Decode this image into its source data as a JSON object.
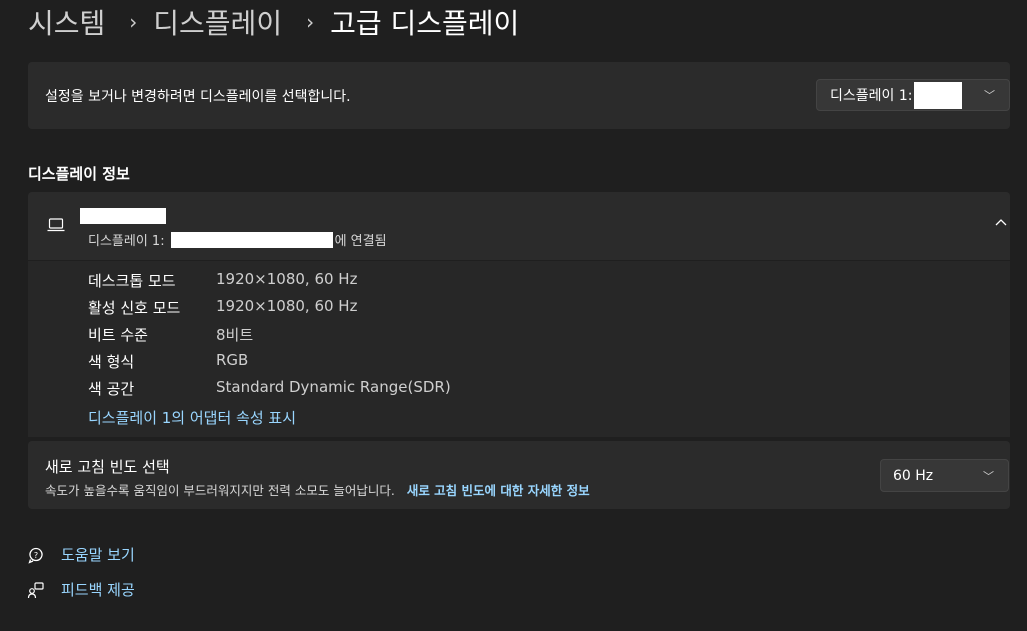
{
  "breadcrumb": {
    "items": [
      "시스템",
      "디스플레이",
      "고급 디스플레이"
    ],
    "separator": "›"
  },
  "display_select": {
    "prompt": "설정을 보거나 변경하려면 디스플레이를 선택합니다.",
    "selected": "디스플레이 1:"
  },
  "info": {
    "section_title": "디스플레이 정보",
    "connection_prefix": "디스플레이 1:",
    "connection_suffix": "에 연결됨",
    "rows": [
      {
        "label": "데스크톱 모드",
        "value": "1920×1080, 60 Hz"
      },
      {
        "label": "활성 신호 모드",
        "value": "1920×1080, 60 Hz"
      },
      {
        "label": "비트 수준",
        "value": "8비트"
      },
      {
        "label": "색 형식",
        "value": "RGB"
      },
      {
        "label": "색 공간",
        "value": "Standard Dynamic Range(SDR)"
      }
    ],
    "adapter_link": "디스플레이 1의 어댑터 속성 표시"
  },
  "refresh": {
    "title": "새로 고침 빈도 선택",
    "description": "속도가 높을수록 움직임이 부드러워지지만 전력 소모도 늘어납니다.",
    "link": "새로 고침 빈도에 대한 자세한 정보",
    "selected": "60 Hz"
  },
  "footer": {
    "help": "도움말 보기",
    "feedback": "피드백 제공"
  },
  "colors": {
    "background": "#1f1f1f",
    "card": "#2b2b2b",
    "link": "#99d6ff"
  }
}
